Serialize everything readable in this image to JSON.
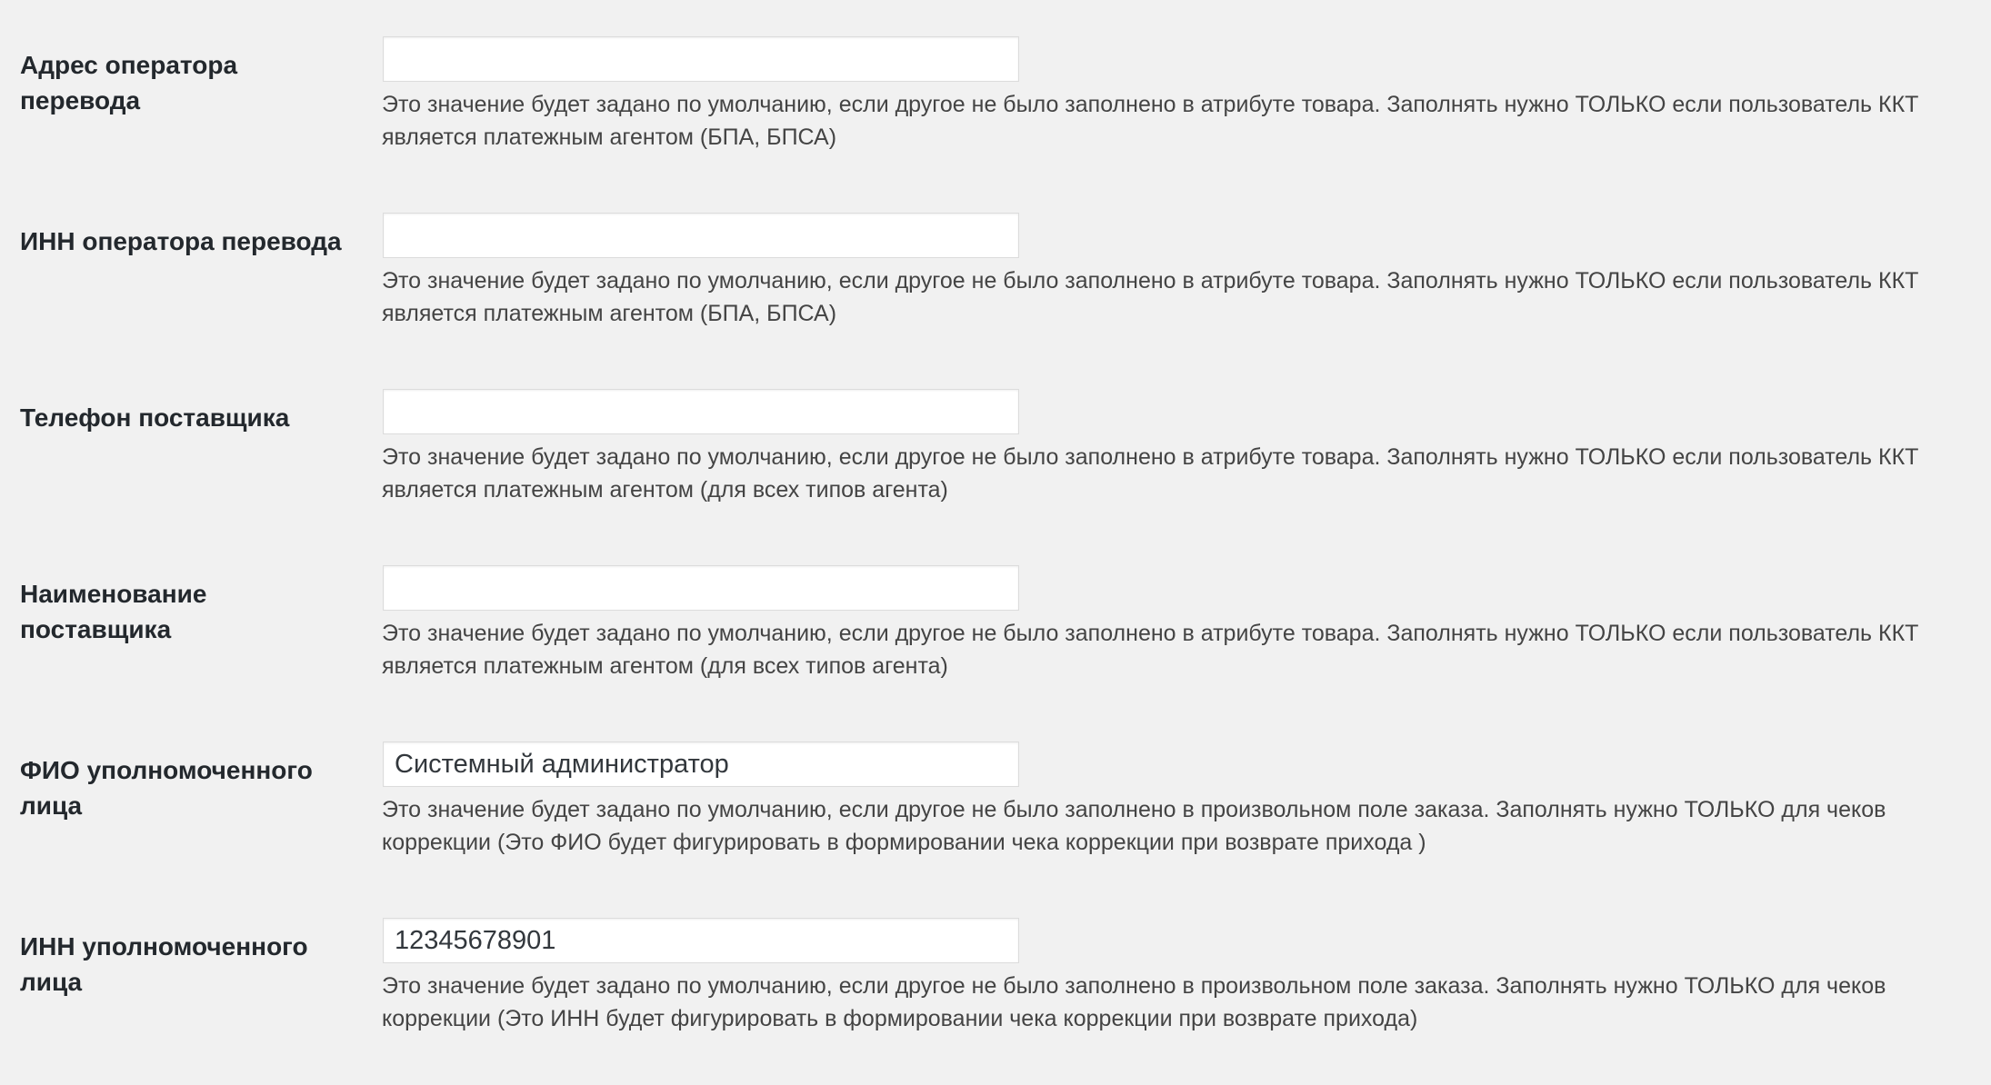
{
  "fields": [
    {
      "label": "Адрес оператора перевода",
      "value": "",
      "description": "Это значение будет задано по умолчанию, если другое не было заполнено в атрибуте товара. Заполнять нужно ТОЛЬКО если пользователь ККТ является платежным агентом (БПА, БПСА)"
    },
    {
      "label": "ИНН оператора перевода",
      "value": "",
      "description": "Это значение будет задано по умолчанию, если другое не было заполнено в атрибуте товара. Заполнять нужно ТОЛЬКО если пользователь ККТ является платежным агентом (БПА, БПСА)"
    },
    {
      "label": "Телефон поставщика",
      "value": "",
      "description": "Это значение будет задано по умолчанию, если другое не было заполнено в атрибуте товара. Заполнять нужно ТОЛЬКО если пользователь ККТ является платежным агентом (для всех типов агента)"
    },
    {
      "label": "Наименование поставщика",
      "value": "",
      "description": "Это значение будет задано по умолчанию, если другое не было заполнено в атрибуте товара. Заполнять нужно ТОЛЬКО если пользователь ККТ является платежным агентом (для всех типов агента)"
    },
    {
      "label": "ФИО уполномоченного лица",
      "value": "Системный администратор",
      "description": "Это значение будет задано по умолчанию, если другое не было заполнено в произвольном поле заказа. Заполнять нужно ТОЛЬКО для чеков коррекции (Это ФИО будет фигурировать в формировании чека коррекции при возврате прихода )"
    },
    {
      "label": "ИНН уполномоченного лица",
      "value": "12345678901",
      "description": "Это значение будет задано по умолчанию, если другое не было заполнено в произвольном поле заказа. Заполнять нужно ТОЛЬКО для чеков коррекции (Это ИНН будет фигурировать в формировании чека коррекции при возврате прихода)"
    }
  ]
}
